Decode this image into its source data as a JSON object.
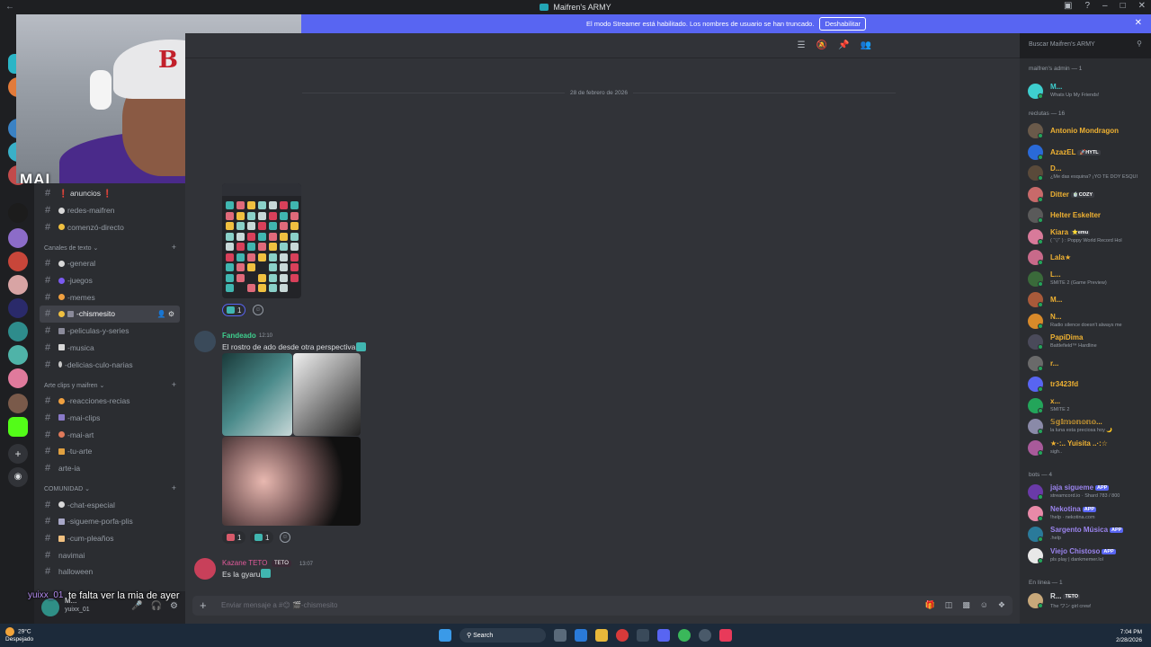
{
  "window": {
    "title": "Maifren's ARMY"
  },
  "banner": {
    "text": "El modo Streamer está habilitado. Los nombres de usuario se han truncado.",
    "button": "Deshabilitar"
  },
  "webcam": {
    "tag": "MAI"
  },
  "sidebar": {
    "top_channels": [
      "❗ anuncios ❗",
      "redes-maifren",
      "comenzó-directo"
    ],
    "categories": [
      {
        "name": "Canales de texto",
        "channels": [
          "-general",
          "-juegos",
          "-memes",
          "-chismesito",
          "-peliculas-y-series",
          "-musica",
          "-delicias-culo-narias"
        ]
      },
      {
        "name": "Arte clips y maifren",
        "channels": [
          "-reacciones-recias",
          "-mai-clips",
          "-mai-art",
          "-tu-arte",
          "arte-ia"
        ]
      },
      {
        "name": "COMUNIDAD",
        "channels": [
          "-chat-especial",
          "-sigueme-porfa-plis",
          "-cum-pleaños",
          "navimai",
          "halloween"
        ]
      }
    ],
    "active_channel": "-chismesito"
  },
  "overlay_chat": {
    "user": "yuixx_01",
    "message": "te falta ver la mia de ayer"
  },
  "user_panel": {
    "name": "M...",
    "status": "yuixx_01"
  },
  "chat": {
    "date_divider": "28 de febrero de 2026",
    "reaction1": {
      "count": "1"
    },
    "message1": {
      "author": "Fandeado",
      "time": "12:10",
      "text": "El rostro de ado desde otra perspectiva"
    },
    "reactions2": [
      "1",
      "1"
    ],
    "message2": {
      "author": "Kazane TETO",
      "badge": "TETO",
      "time": "13:07",
      "text": "Es la gyaru"
    },
    "composer_placeholder": "Enviar mensaje a #😊 🎬-chismesito"
  },
  "search": {
    "placeholder": "Buscar Maifren's ARMY"
  },
  "members": {
    "groups": [
      {
        "title": "maifren's admin — 1",
        "members": [
          {
            "name": "M...",
            "sub": "Whats Up My Friends!",
            "color": "#3ecfcf"
          }
        ]
      },
      {
        "title": "reclutas — 16",
        "members": [
          {
            "name": "Antonio Mondragon",
            "sub": "",
            "color": "#f0b232"
          },
          {
            "name": "AzazEL",
            "badge": "🚀HYTL",
            "sub": "",
            "color": "#f0b232"
          },
          {
            "name": "D...",
            "sub": "¿Me das esquina? ¡YO TE DOY ESQUI",
            "color": "#f0b232"
          },
          {
            "name": "Ditter",
            "badge": "🍵COZY",
            "sub": "",
            "color": "#f0b232"
          },
          {
            "name": "Helter Eskelter",
            "sub": "",
            "color": "#f0b232"
          },
          {
            "name": "Kiara",
            "badge": "⭐emu",
            "sub": "( ˘▽˘ ) : Poppy World Record Hol",
            "color": "#f0b232"
          },
          {
            "name": "Lala★",
            "sub": "",
            "color": "#f0b232"
          },
          {
            "name": "L...",
            "sub": "SMITE 2 (Game Preview)",
            "color": "#f0b232"
          },
          {
            "name": "M...",
            "sub": "",
            "color": "#f0b232"
          },
          {
            "name": "N...",
            "sub": "Radio silence doesn't always me",
            "color": "#f0b232"
          },
          {
            "name": "PapiDima",
            "sub": "Battlefield™ Hardline",
            "color": "#f0b232"
          },
          {
            "name": "r...",
            "sub": "",
            "color": "#f0b232"
          },
          {
            "name": "tr3423fd",
            "sub": "",
            "color": "#f0b232"
          },
          {
            "name": "x...",
            "sub": "SMITE 2",
            "color": "#f0b232"
          },
          {
            "name": "𝕊𝕘𝕚𝕞𝕠𝕟𝕠𝕟𝕠...",
            "sub": "la luna esta preciosa hoy 🌙",
            "color": "#f0b232"
          },
          {
            "name": "★·:.. Yuisita ..·:☆",
            "sub": "sigh..",
            "color": "#f0b232"
          }
        ]
      },
      {
        "title": "bots — 4",
        "members": [
          {
            "name": "jaja sigueme",
            "badge": "APP",
            "sub": "streamcord.io · Shard 783 / 800",
            "color": "#9b84ee"
          },
          {
            "name": "Nekotina",
            "badge": "APP",
            "sub": "!help · nekotina.com",
            "color": "#9b84ee"
          },
          {
            "name": "Sargento Música",
            "badge": "APP",
            "sub": ".help",
            "color": "#9b84ee"
          },
          {
            "name": "Viejo Chistoso",
            "badge": "APP",
            "sub": "pls play | dankmemer.lol",
            "color": "#9b84ee"
          }
        ]
      },
      {
        "title": "En línea — 1",
        "members": [
          {
            "name": "R...",
            "badge": "TETO",
            "sub": "The ワン girl crew!",
            "color": "#dbdee1"
          }
        ]
      }
    ]
  },
  "taskbar": {
    "weather_temp": "29°C",
    "weather_desc": "Despejado",
    "search": "Search",
    "time": "7:04 PM",
    "date": "2/28/2026"
  }
}
